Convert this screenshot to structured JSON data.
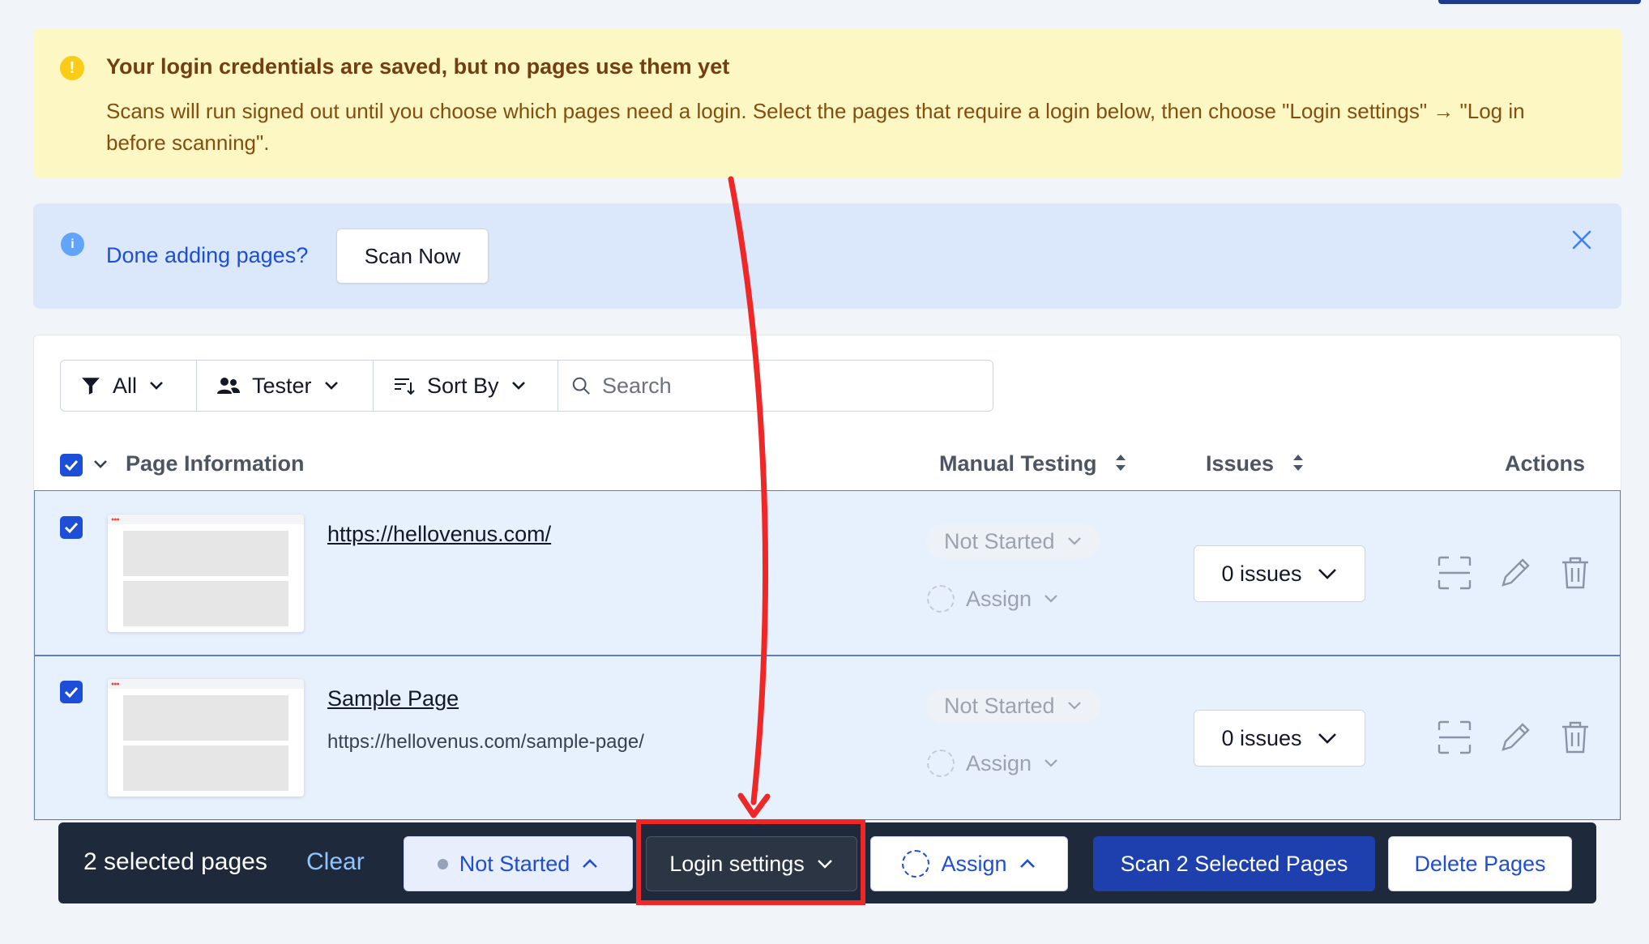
{
  "warning": {
    "title": "Your login credentials are saved, but no pages use them yet",
    "body": "Scans will run signed out until you choose which pages need a login. Select the pages that require a login below, then choose \"Login settings\" → \"Log in before scanning\".",
    "icon": "alert-icon"
  },
  "info": {
    "text": "Done adding pages?",
    "scan_now": "Scan Now",
    "icon": "info-icon"
  },
  "filters": {
    "all": "All",
    "tester": "Tester",
    "sort_by": "Sort By",
    "search_placeholder": "Search"
  },
  "columns": {
    "page_info": "Page Information",
    "manual_testing": "Manual Testing",
    "issues": "Issues",
    "actions": "Actions"
  },
  "rows": [
    {
      "title": "https://hellovenus.com/",
      "url": "",
      "status": "Not Started",
      "assign": "Assign",
      "issues": "0 issues",
      "checked": true
    },
    {
      "title": "Sample Page",
      "url": "https://hellovenus.com/sample-page/",
      "status": "Not Started",
      "assign": "Assign",
      "issues": "0 issues",
      "checked": true
    }
  ],
  "actionbar": {
    "selected": "2 selected pages",
    "clear": "Clear",
    "status": "Not Started",
    "login_settings": "Login settings",
    "assign": "Assign",
    "scan_selected": "Scan 2 Selected Pages",
    "delete": "Delete Pages"
  },
  "colors": {
    "highlight": "#ef2727",
    "primary": "#1e40af",
    "warning_bg": "#fdf7c3",
    "info_bg": "#dbe8fb"
  }
}
